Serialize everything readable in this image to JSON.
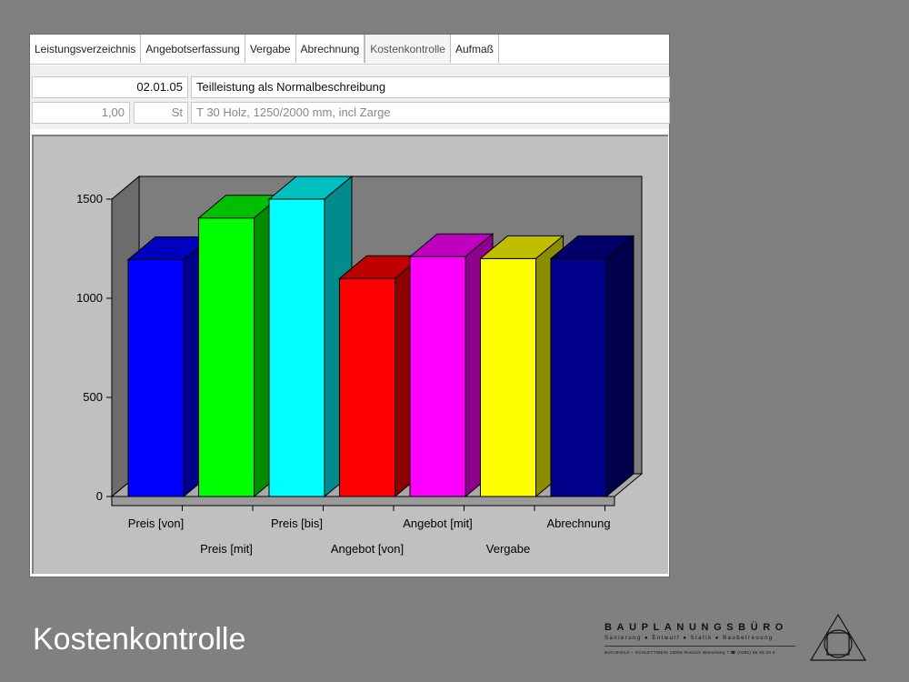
{
  "tabs": [
    {
      "label": "Leistungsverzeichnis",
      "active": false
    },
    {
      "label": "Angebotserfassung",
      "active": false
    },
    {
      "label": "Vergabe",
      "active": false
    },
    {
      "label": "Abrechnung",
      "active": false
    },
    {
      "label": "Kostenkontrolle",
      "active": true
    },
    {
      "label": "Aufmaß",
      "active": false
    }
  ],
  "position": {
    "code": "02.01.05",
    "short_text": "Teilleistung als Normalbeschreibung",
    "quantity": "1,00",
    "unit": "St",
    "long_text": "T 30 Holz, 1250/2000 mm,  incl Zarge"
  },
  "chart_data": {
    "type": "bar",
    "style": "3d",
    "categories": [
      "Preis [von]",
      "Preis [mit]",
      "Preis [bis]",
      "Angebot [von]",
      "Angebot [mit]",
      "Vergabe",
      "Abrechnung"
    ],
    "values": [
      1195,
      1405,
      1500,
      1100,
      1210,
      1200,
      1200
    ],
    "colors": [
      "#0000ff",
      "#00ff00",
      "#00ffff",
      "#ff0000",
      "#ff00ff",
      "#ffff00",
      "#00008b"
    ],
    "ylim": [
      0,
      1500
    ],
    "yticks": [
      "0",
      "500",
      "1000",
      "1500"
    ],
    "title": "",
    "xlabel": "",
    "ylabel": ""
  },
  "slide_title": "Kostenkontrolle",
  "logo": {
    "name": "BAUPLANUNGSBÜRO",
    "services": "Sanierung  ●  Entwurf  ●  Statik  ●  Baubetreuung",
    "address": "BUCHHOLZ + SCHLETTWEIN     18055 Rostock     Wamelweg 7     ☎ (0381) 66 66 28 4"
  }
}
